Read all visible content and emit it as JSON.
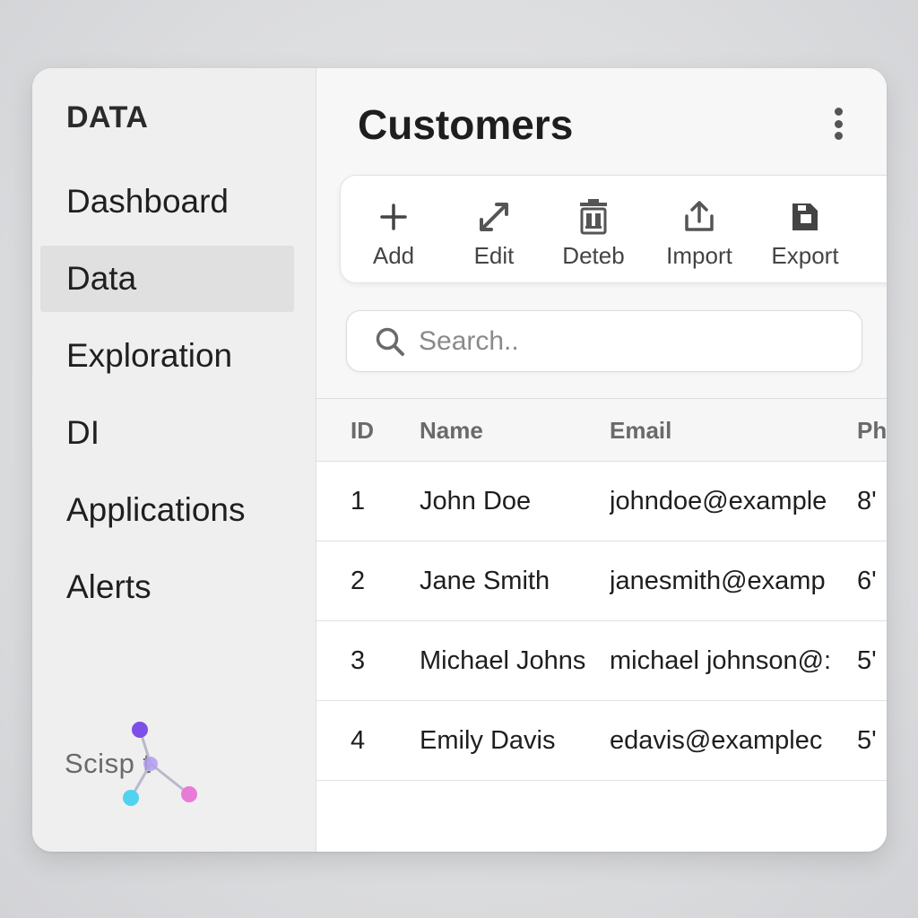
{
  "sidebar": {
    "brand": "DATA",
    "items": [
      {
        "label": "Dashboard",
        "active": false
      },
      {
        "label": "Data",
        "active": true
      },
      {
        "label": "Exploration",
        "active": false
      },
      {
        "label": "DI",
        "active": false
      },
      {
        "label": "Applications",
        "active": false
      },
      {
        "label": "Alerts",
        "active": false
      }
    ],
    "logo_text": "Scisp t"
  },
  "header": {
    "title": "Customers",
    "menu_icon": "kebab-menu-icon"
  },
  "toolbar": {
    "buttons": [
      {
        "label": "Add",
        "icon": "plus-icon"
      },
      {
        "label": "Edit",
        "icon": "edit-arrow-icon"
      },
      {
        "label": "Deteb",
        "icon": "trash-icon"
      },
      {
        "label": "Import",
        "icon": "upload-icon"
      },
      {
        "label": "Export",
        "icon": "export-file-icon"
      }
    ]
  },
  "search": {
    "placeholder": "Search..",
    "value": ""
  },
  "table": {
    "columns": [
      "ID",
      "Name",
      "Email",
      "Ph"
    ],
    "rows": [
      {
        "id": "1",
        "name": "John Doe",
        "email": "johndoe@example",
        "phone": "8'"
      },
      {
        "id": "2",
        "name": "Jane Smith",
        "email": "janesmith@examp",
        "phone": "6'"
      },
      {
        "id": "3",
        "name": "Michael Johns",
        "email": "michael johnson@:",
        "phone": "5'"
      },
      {
        "id": "4",
        "name": "Emily Davis",
        "email": "edavis@examplec",
        "phone": "5'"
      }
    ]
  },
  "colors": {
    "sidebar_bg": "#efefef",
    "active_item_bg": "#e0e0e0",
    "logo_purple": "#7b4fe8",
    "logo_cyan": "#4fd3f0",
    "logo_pink": "#e87bd6"
  }
}
